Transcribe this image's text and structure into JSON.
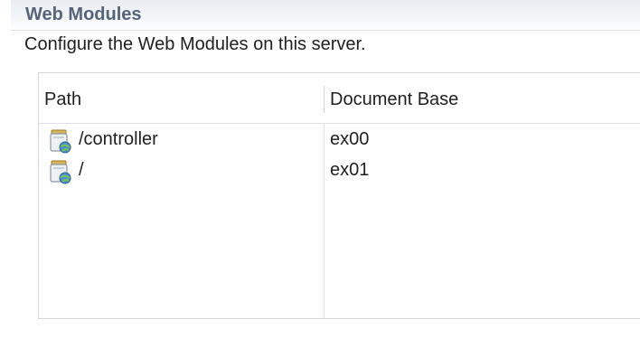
{
  "section": {
    "title": "Web Modules",
    "description": "Configure the Web Modules on this server."
  },
  "table": {
    "columns": [
      "Path",
      "Document Base"
    ],
    "rows": [
      {
        "path": "/controller",
        "document_base": "ex00",
        "icon": "web-module-icon"
      },
      {
        "path": "/",
        "document_base": "ex01",
        "icon": "web-module-icon"
      }
    ]
  },
  "colors": {
    "header_title": "#56637a",
    "header_bg": "#e9edf3",
    "grid_line": "#d6d6d6"
  }
}
